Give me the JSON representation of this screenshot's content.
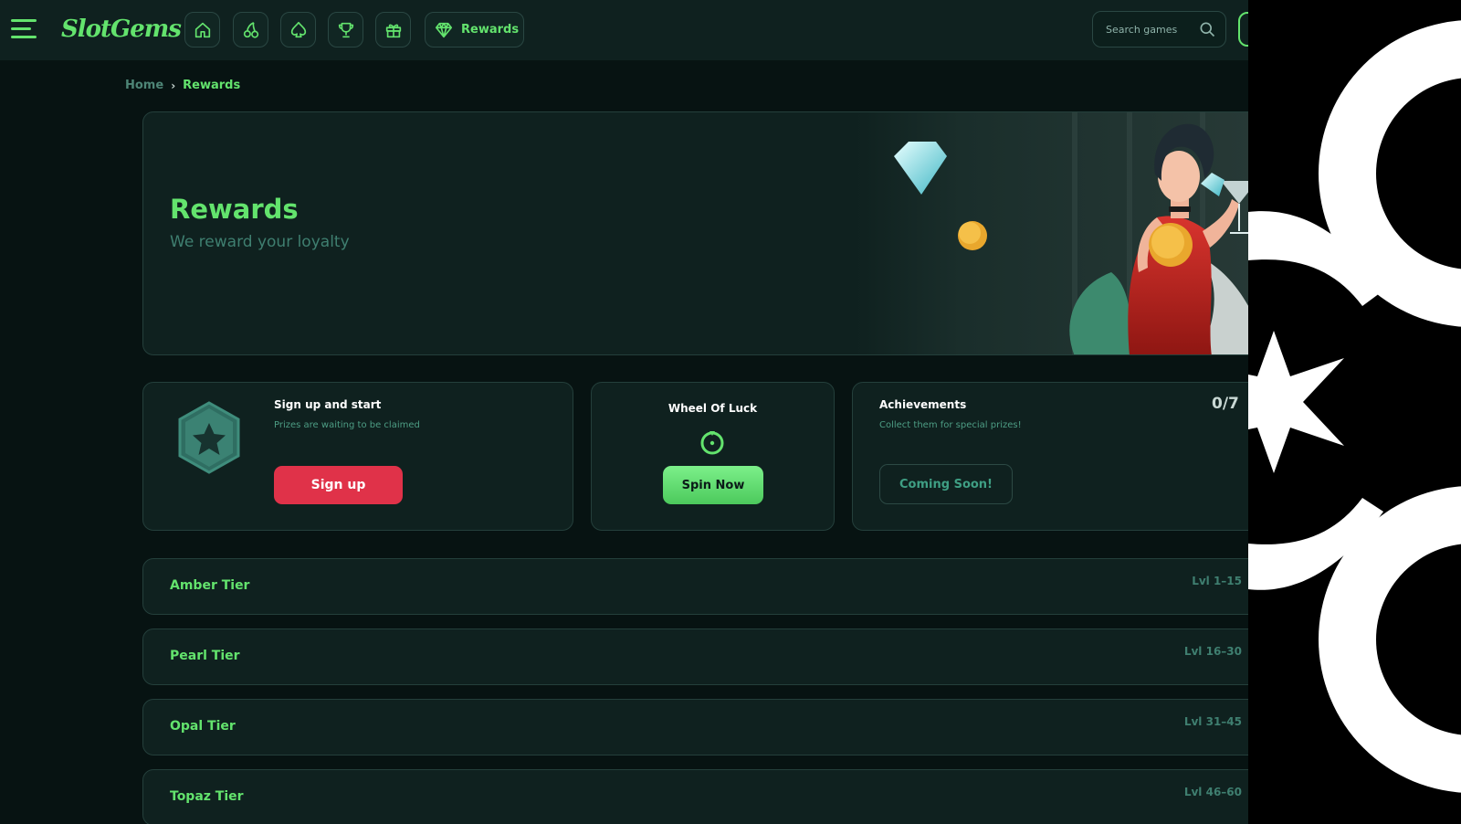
{
  "header": {
    "logo": "SlotGems",
    "nav_rewards_label": "Rewards",
    "search_placeholder": "Search games"
  },
  "breadcrumb": {
    "home": "Home",
    "separator": "›",
    "current": "Rewards"
  },
  "hero": {
    "title": "Rewards",
    "subtitle": "We reward your loyalty"
  },
  "signup_card": {
    "title": "Sign up and start",
    "subtitle": "Prizes are waiting to be claimed",
    "button": "Sign up"
  },
  "wheel_card": {
    "title": "Wheel Of Luck",
    "button": "Spin Now"
  },
  "achievements_card": {
    "title": "Achievements",
    "subtitle": "Collect them for special prizes!",
    "count": "0/7",
    "button": "Coming Soon!"
  },
  "tiers": [
    {
      "name": "Amber Tier",
      "levels": "Lvl 1–15"
    },
    {
      "name": "Pearl Tier",
      "levels": "Lvl 16–30"
    },
    {
      "name": "Opal Tier",
      "levels": "Lvl 31–45"
    },
    {
      "name": "Topaz Tier",
      "levels": "Lvl 46–60"
    }
  ],
  "colors": {
    "accent": "#63e36d",
    "background": "#071312",
    "panel": "#0f211f",
    "signup_button": "#e03249",
    "muted_text": "#3f7f70"
  },
  "icons": {
    "menu": "hamburger-icon",
    "home": "home-icon",
    "slots": "cherry-icon",
    "table_games": "spade-icon",
    "tournaments": "trophy-icon",
    "promotions": "gift-icon",
    "rewards": "diamond-icon",
    "search": "search-icon",
    "badge": "star-badge-icon",
    "wheel": "wheel-icon"
  }
}
